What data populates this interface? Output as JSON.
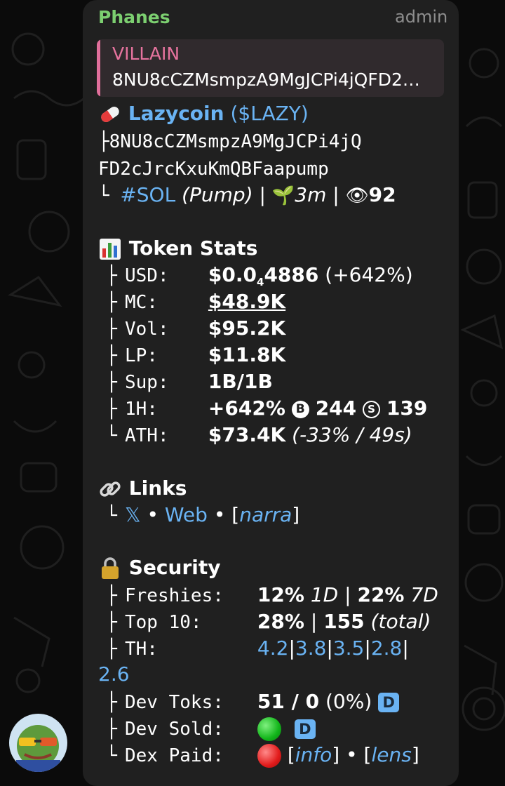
{
  "sender": "Phanes",
  "admin_label": "admin",
  "reply": {
    "name": "VILLAIN",
    "text": "8NU8cCZMsmpzA9MgJCPi4jQFD2…"
  },
  "token": {
    "pill_icon": "pill-icon",
    "name": "Lazycoin",
    "ticker": "($LAZY)",
    "address_line1": "8NU8cCZMsmpzA9MgJCPi4jQ",
    "address_line2": "FD2cJrcKxuKmQBFaapump",
    "chain": "#SOL",
    "platform": "(Pump)",
    "sep": "|",
    "age": "3m",
    "views": "92"
  },
  "stats": {
    "title": "Token Stats",
    "usd_key": "USD:",
    "usd_prefix": "$0.0",
    "usd_sub": "4",
    "usd_rest": "4886",
    "usd_change": "(+642%)",
    "mc_key": "MC:",
    "mc": "$48.9K",
    "vol_key": "Vol:",
    "vol": "$95.2K",
    "lp_key": "LP:",
    "lp": "$11.8K",
    "sup_key": "Sup:",
    "sup": "1B/1B",
    "h1_key": "1H:",
    "h1_change": "+642%",
    "buy_glyph": "B",
    "buys": "244",
    "sell_glyph": "S",
    "sells": "139",
    "ath_key": "ATH:",
    "ath": "$73.4K",
    "ath_detail": "(-33% / 49s)"
  },
  "links": {
    "title": "Links",
    "x": "𝕏",
    "bullet": "•",
    "web": "Web",
    "narra_open": "[",
    "narra": "narra",
    "narra_close": "]"
  },
  "security": {
    "title": "Security",
    "fresh_key": "Freshies:",
    "fresh_1d": "12%",
    "fresh_1d_label": "1D",
    "fresh_7d": "22%",
    "fresh_7d_label": "7D",
    "top10_key": "Top 10:",
    "top10": "28%",
    "top10_total": "155",
    "top10_total_label": "(total)",
    "th_key": "TH:",
    "th": [
      "4.2",
      "3.8",
      "3.5",
      "2.8",
      "2.6"
    ],
    "devtoks_key": "Dev Toks:",
    "devtoks": "51 / 0",
    "devtoks_pct": "(0%)",
    "badge": "D",
    "devsold_key": "Dev Sold:",
    "dexpaid_key": "Dex Paid:",
    "info": "info",
    "lens": "lens"
  },
  "colors": {
    "background": "#0b0b0b",
    "bubble": "#202020",
    "sender": "#7ccf70",
    "reply_accent": "#e06f9b",
    "link": "#6ab3f3"
  }
}
